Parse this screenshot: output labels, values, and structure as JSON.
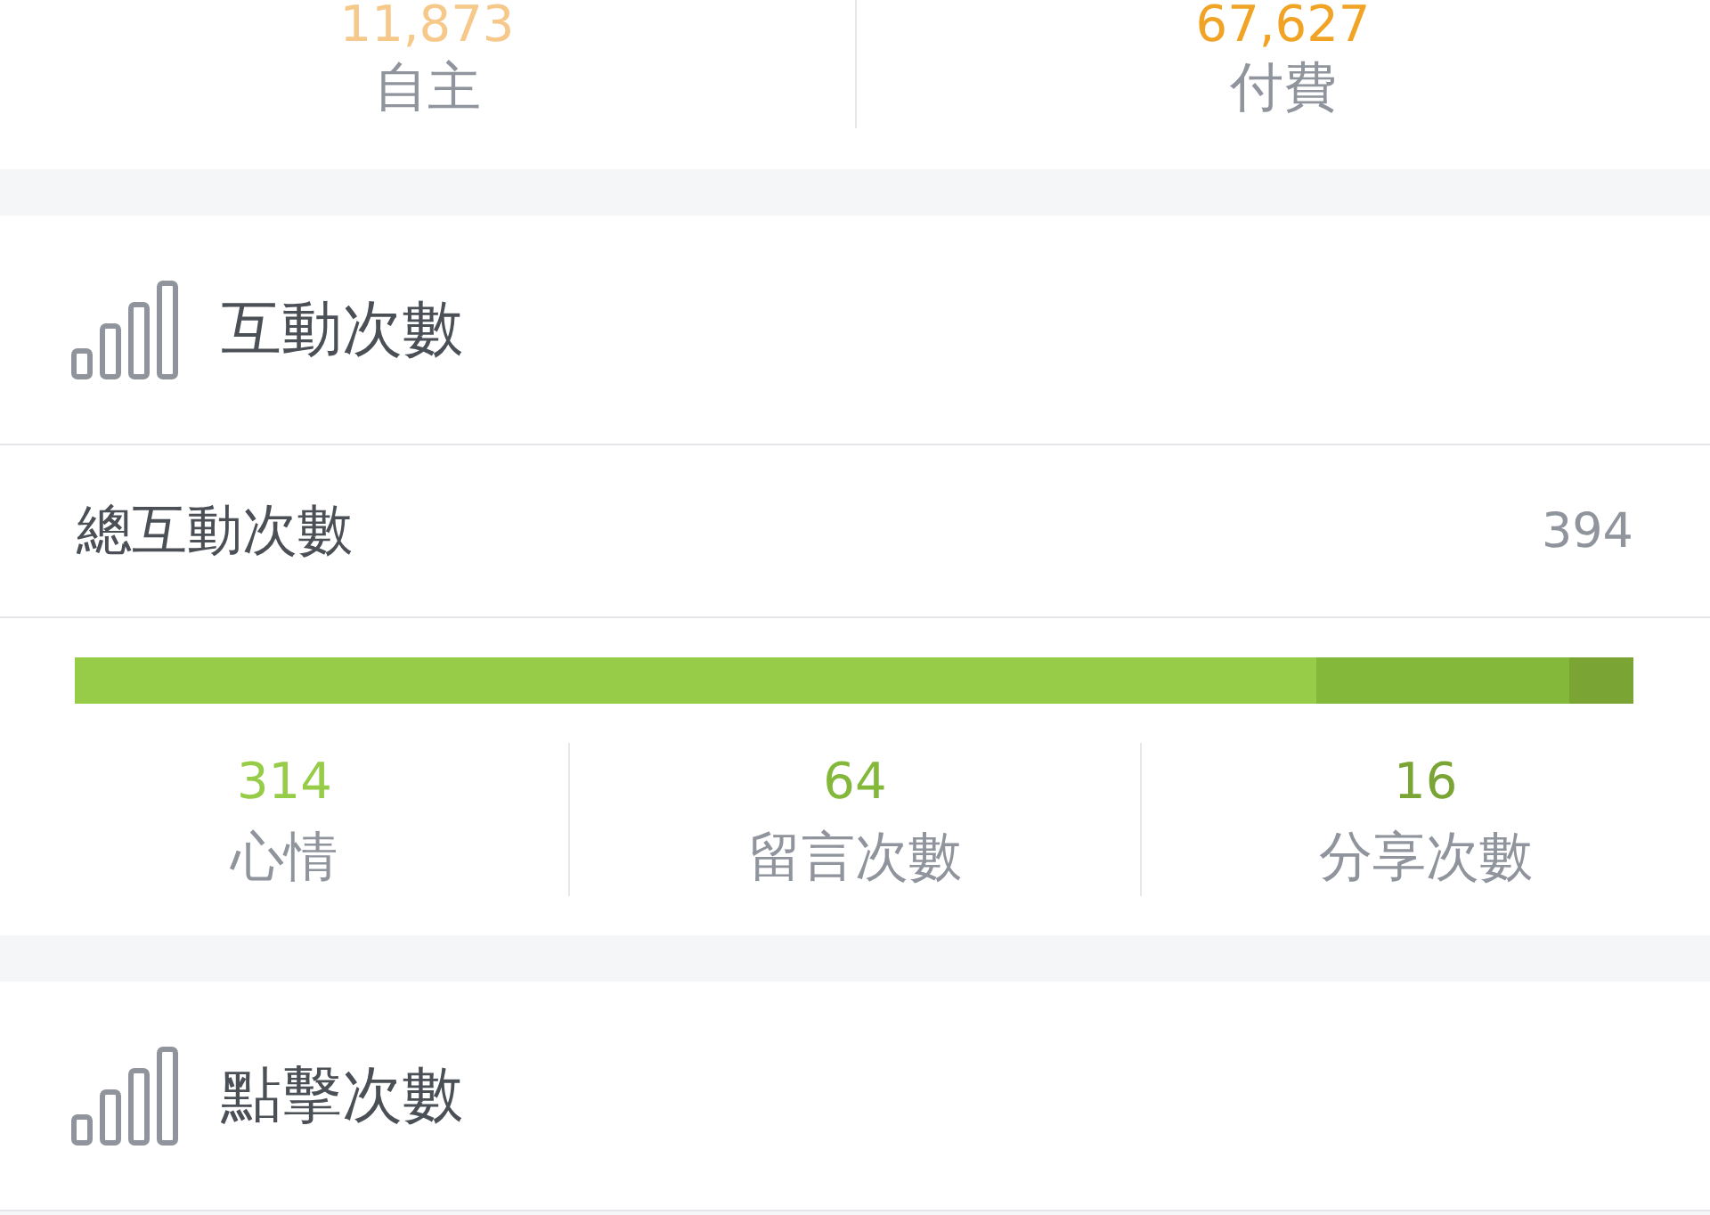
{
  "summary": {
    "items": [
      {
        "value": "11,873",
        "label": "自主",
        "color": "#f6c889"
      },
      {
        "value": "67,627",
        "label": "付費",
        "color": "#f0a324"
      }
    ]
  },
  "sections": [
    {
      "title": "互動次數",
      "total": {
        "label": "總互動次數",
        "value": "394"
      },
      "breakdown": [
        {
          "value": "314",
          "label": "心情",
          "color": "#96cc48"
        },
        {
          "value": "64",
          "label": "留言次數",
          "color": "#84b83a"
        },
        {
          "value": "16",
          "label": "分享次數",
          "color": "#7aa534"
        }
      ]
    },
    {
      "title": "點擊次數"
    }
  ]
}
